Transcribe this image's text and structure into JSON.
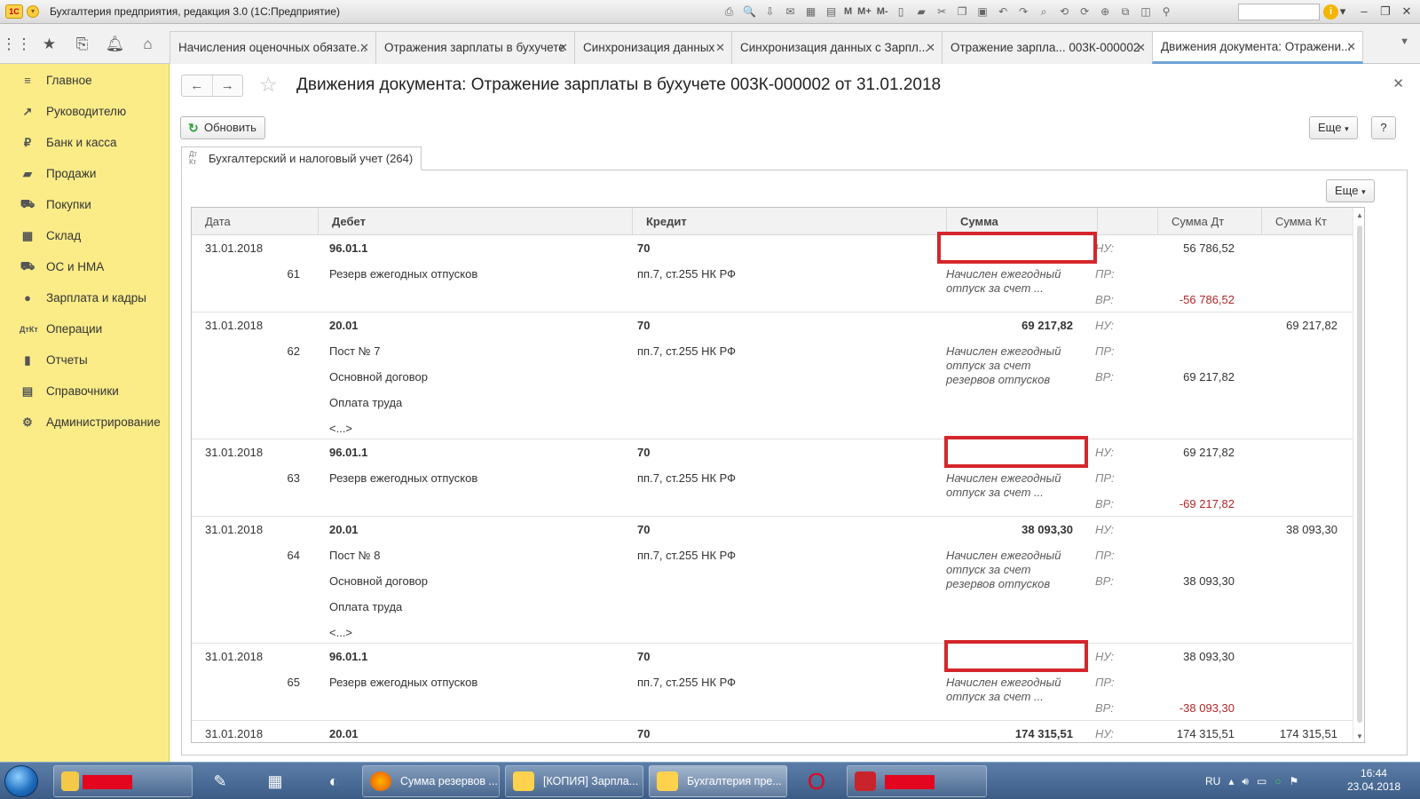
{
  "window": {
    "app_title": "Бухгалтерия предприятия, редакция 3.0  (1С:Предприятие)",
    "toolbar_letters": [
      "M",
      "M+",
      "M-"
    ]
  },
  "tabs": [
    {
      "label": "Начисления оценочных обязате..."
    },
    {
      "label": "Отражения зарплаты в бухучете"
    },
    {
      "label": "Синхронизация данных"
    },
    {
      "label": "Синхронизация данных с Зарпл..."
    },
    {
      "label": "Отражение зарпла...   003К-000002"
    },
    {
      "label": "Движения документа: Отражени..."
    }
  ],
  "sidebar": {
    "items": [
      {
        "label": "Главное",
        "icon": "menu-icon"
      },
      {
        "label": "Руководителю",
        "icon": "trend-icon"
      },
      {
        "label": "Банк и касса",
        "icon": "ruble-icon"
      },
      {
        "label": "Продажи",
        "icon": "bag-icon"
      },
      {
        "label": "Покупки",
        "icon": "cart-icon"
      },
      {
        "label": "Склад",
        "icon": "grid-icon"
      },
      {
        "label": "ОС и НМА",
        "icon": "truck-icon"
      },
      {
        "label": "Зарплата и кадры",
        "icon": "person-icon"
      },
      {
        "label": "Операции",
        "icon": "dt-kt-icon"
      },
      {
        "label": "Отчеты",
        "icon": "bar-chart-icon"
      },
      {
        "label": "Справочники",
        "icon": "book-icon"
      },
      {
        "label": "Администрирование",
        "icon": "gear-icon"
      }
    ]
  },
  "form": {
    "title": "Движения документа: Отражение зарплаты в бухучете 003К-000002 от 31.01.2018",
    "refresh_label": "Обновить",
    "more_label": "Еще",
    "help_label": "?",
    "sheet_tab_label": "Бухгалтерский и налоговый учет (264)",
    "dt_kt": [
      "Дт",
      "Кт"
    ]
  },
  "table": {
    "headers": [
      "Дата",
      "Дебет",
      "Кредит",
      "Сумма",
      "",
      "Сумма Дт",
      "Сумма Кт"
    ],
    "tax_labels": [
      "НУ:",
      "ПР:",
      "ВР:"
    ],
    "rows": [
      {
        "date": "31.01.2018",
        "num": "61",
        "debit_account": "96.01.1",
        "debit_sub": [
          "Резерв ежегодных отпусков"
        ],
        "credit_account": "70",
        "credit_sub": "пп.7, ст.255 НК РФ",
        "amount": "",
        "content": "Начислен ежегодный отпуск за счет ...",
        "nu_dt": "56 786,52",
        "vr_dt": "-56 786,52",
        "nu_kt": "",
        "redacted": true
      },
      {
        "date": "31.01.2018",
        "num": "62",
        "debit_account": "20.01",
        "debit_sub": [
          "Пост № 7",
          "Основной договор",
          "Оплата труда",
          "<...>"
        ],
        "credit_account": "70",
        "credit_sub": "пп.7, ст.255 НК РФ",
        "amount": "69 217,82",
        "content": "Начислен ежегодный отпуск за счет резервов отпусков",
        "nu_dt": "",
        "vr_dt": "69 217,82",
        "nu_kt": "69 217,82",
        "redacted": false
      },
      {
        "date": "31.01.2018",
        "num": "63",
        "debit_account": "96.01.1",
        "debit_sub": [
          "Резерв ежегодных отпусков"
        ],
        "credit_account": "70",
        "credit_sub": "пп.7, ст.255 НК РФ",
        "amount": "",
        "content": "Начислен ежегодный отпуск за счет ...",
        "nu_dt": "69 217,82",
        "vr_dt": "-69 217,82",
        "nu_kt": "",
        "redacted": true
      },
      {
        "date": "31.01.2018",
        "num": "64",
        "debit_account": "20.01",
        "debit_sub": [
          "Пост № 8",
          "Основной договор",
          "Оплата труда",
          "<...>"
        ],
        "credit_account": "70",
        "credit_sub": "пп.7, ст.255 НК РФ",
        "amount": "38 093,30",
        "content": "Начислен ежегодный отпуск за счет резервов отпусков",
        "nu_dt": "",
        "vr_dt": "38 093,30",
        "nu_kt": "38 093,30",
        "redacted": false
      },
      {
        "date": "31.01.2018",
        "num": "65",
        "debit_account": "96.01.1",
        "debit_sub": [
          "Резерв ежегодных отпусков"
        ],
        "credit_account": "70",
        "credit_sub": "пп.7, ст.255 НК РФ",
        "amount": "",
        "content": "Начислен ежегодный отпуск за счет ...",
        "nu_dt": "38 093,30",
        "vr_dt": "-38 093,30",
        "nu_kt": "",
        "redacted": true
      },
      {
        "date": "31.01.2018",
        "num": "",
        "debit_account": "20.01",
        "debit_sub": [],
        "credit_account": "70",
        "credit_sub": "",
        "amount": "174 315,51",
        "content": "",
        "nu_dt": "174 315,51",
        "vr_dt": "",
        "nu_kt": "174 315,51",
        "redacted": false
      }
    ]
  },
  "taskbar": {
    "items": [
      {
        "label": "Сумма резервов ..."
      },
      {
        "label": "[КОПИЯ] Зарпла..."
      },
      {
        "label": "Бухгалтерия пре..."
      }
    ],
    "lang": "RU",
    "time": "16:44",
    "date": "23.04.2018"
  }
}
